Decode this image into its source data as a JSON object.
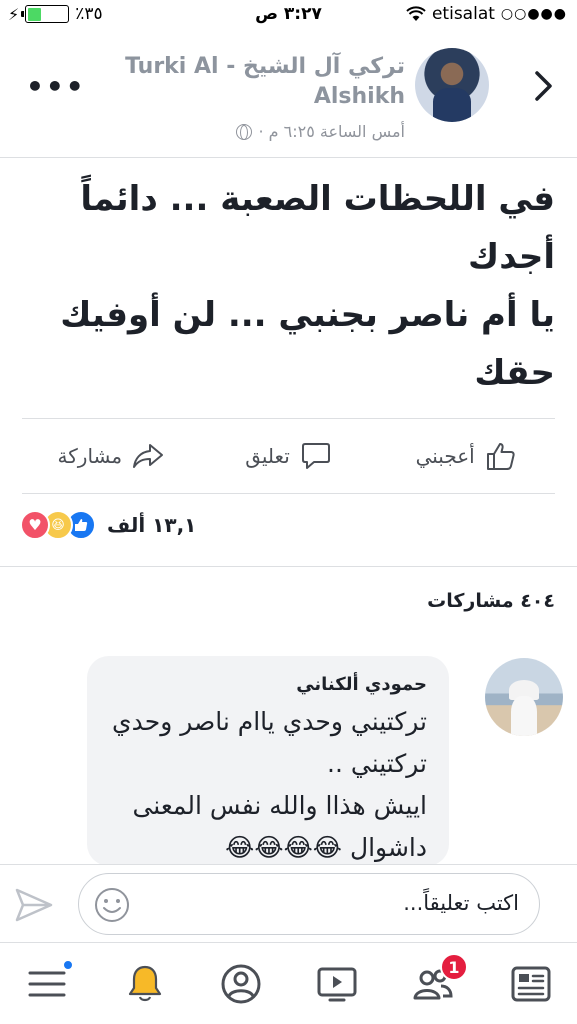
{
  "status_bar": {
    "battery_percent": "٪٣٥",
    "battery_level": 0.35,
    "time": "٣:٢٧ ص",
    "carrier": "etisalat",
    "signal_dots": "○○●●●"
  },
  "header": {
    "author_name": "تركي آل الشيخ - Turki Al Alshikh",
    "post_time": "أمس الساعة ٦:٢٥ م ·"
  },
  "post": {
    "text": "في اللحظات الصعبة  ... دائماً أجدك\n يا أم ناصر بجنبي ... لن أوفيك حقك"
  },
  "actions": {
    "like_label": "أعجبني",
    "comment_label": "تعليق",
    "share_label": "مشاركة"
  },
  "reactions": {
    "count": "١٣,١ ألف"
  },
  "shares": {
    "label": "٤٠٤ مشاركات"
  },
  "comment": {
    "author": "حمودي ألكناني",
    "text": "تركتيني وحدي ياام ناصر وحدي تركتيني ..\nاييش هذاا والله نفس المعنى داشوال 😂😂😂😂"
  },
  "composer": {
    "placeholder": "اكتب تعليقاً..."
  },
  "bottom_nav": {
    "friends_badge": "1"
  },
  "colors": {
    "accent": "#1877f2",
    "badge": "#e41e3f",
    "battery": "#4cd964"
  }
}
